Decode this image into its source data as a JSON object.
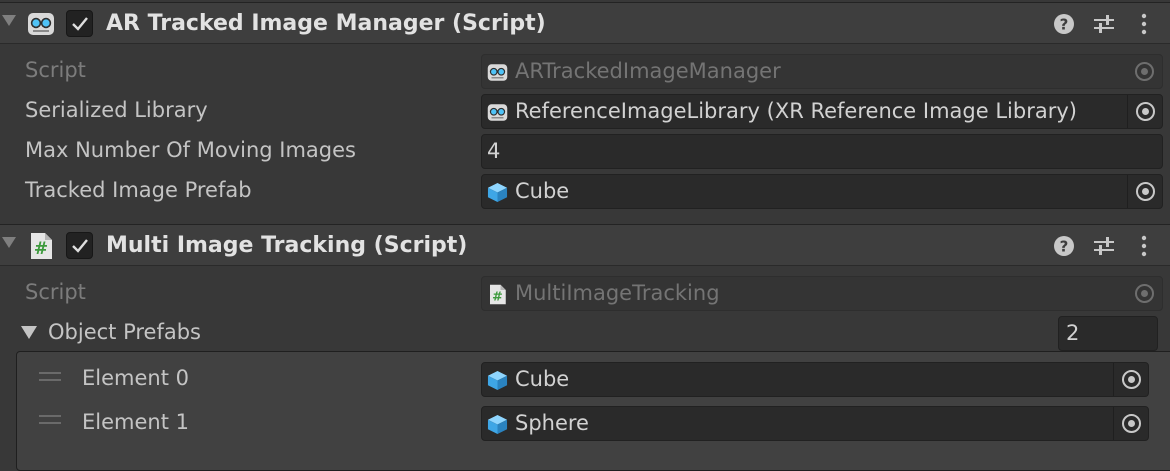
{
  "components": [
    {
      "title": "AR Tracked Image Manager (Script)",
      "icon": "ar-foundation-icon",
      "enabled": true,
      "rows": [
        {
          "label": "Script",
          "value": "ARTrackedImageManager",
          "icon": "ar-foundation-icon",
          "disabled": true
        },
        {
          "label": "Serialized Library",
          "value": "ReferenceImageLibrary (XR Reference Image Library)",
          "icon": "ar-foundation-icon"
        },
        {
          "label": "Max Number Of Moving Images",
          "value": "4"
        },
        {
          "label": "Tracked Image Prefab",
          "value": "Cube",
          "icon": "prefab-cube-icon"
        }
      ]
    },
    {
      "title": "Multi Image Tracking (Script)",
      "icon": "csharp-script-icon",
      "enabled": true,
      "rows": [
        {
          "label": "Script",
          "value": "MultiImageTracking",
          "icon": "csharp-script-icon",
          "disabled": true
        }
      ],
      "list": {
        "label": "Object Prefabs",
        "size": "2",
        "elements": [
          {
            "label": "Element 0",
            "value": "Cube",
            "icon": "prefab-cube-icon"
          },
          {
            "label": "Element 1",
            "value": "Sphere",
            "icon": "prefab-cube-icon"
          }
        ]
      }
    }
  ],
  "header_buttons": [
    "help-icon",
    "preset-sliders-icon",
    "kebab-menu-icon"
  ],
  "colors": {
    "background": "#383838",
    "header": "#3e3e3e",
    "field": "#2a2a2a",
    "prefab": "#5cb8f0",
    "script": "#4aa84a"
  }
}
